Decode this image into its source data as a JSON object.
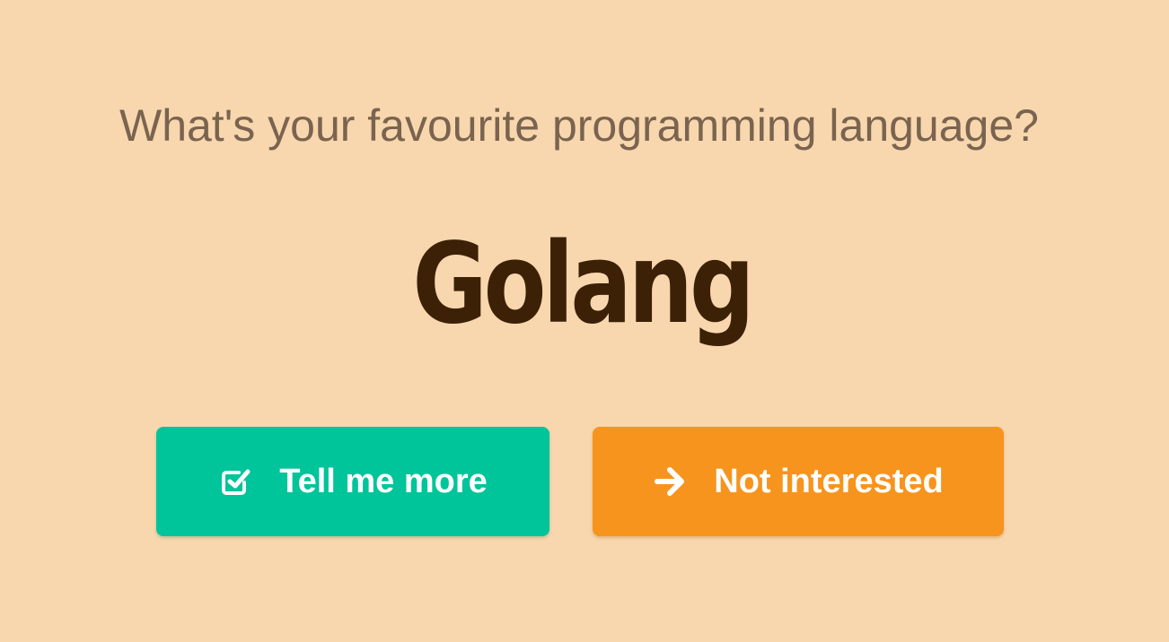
{
  "prompt": {
    "question": "What's your favourite programming language?"
  },
  "answer": {
    "language": "Golang"
  },
  "actions": {
    "more_label": "Tell me more",
    "more_icon": "check-square-icon",
    "not_interested_label": "Not interested",
    "not_interested_icon": "arrow-right-icon"
  },
  "colors": {
    "background": "#f8d7ae",
    "question_text": "#7a6450",
    "language_text": "#3c2107",
    "more_button": "#00c49a",
    "not_interested_button": "#f7941d",
    "button_text": "#ffffff"
  }
}
